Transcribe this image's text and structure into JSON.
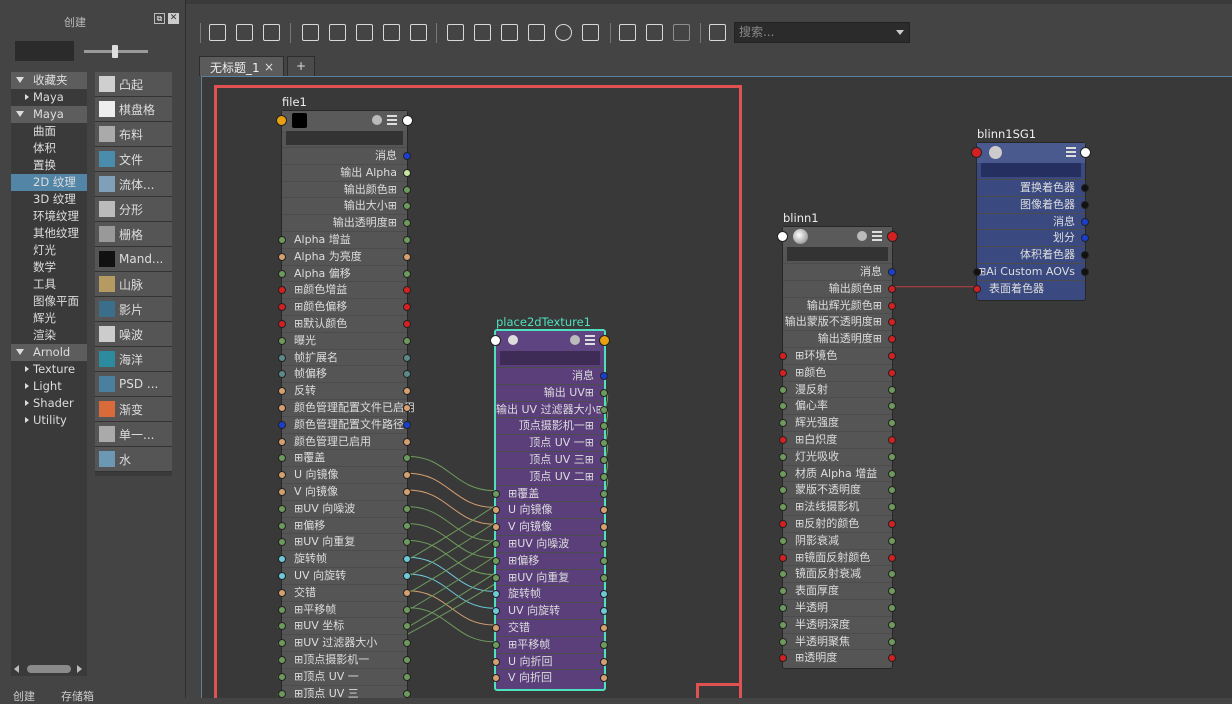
{
  "left_panel": {
    "title": "创建",
    "float_icon": "float-panel-icon",
    "close_icon": "close-icon",
    "categories": [
      {
        "label": "收藏夹",
        "kind": "group"
      },
      {
        "label": "Maya",
        "kind": "sub"
      },
      {
        "label": "Maya",
        "kind": "group"
      },
      {
        "label": "曲面",
        "kind": "item"
      },
      {
        "label": "体积",
        "kind": "item"
      },
      {
        "label": "置换",
        "kind": "item"
      },
      {
        "label": "2D 纹理",
        "kind": "item",
        "selected": true
      },
      {
        "label": "3D 纹理",
        "kind": "item"
      },
      {
        "label": "环境纹理",
        "kind": "item"
      },
      {
        "label": "其他纹理",
        "kind": "item"
      },
      {
        "label": "灯光",
        "kind": "item"
      },
      {
        "label": "数学",
        "kind": "item"
      },
      {
        "label": "工具",
        "kind": "item"
      },
      {
        "label": "图像平面",
        "kind": "item"
      },
      {
        "label": "辉光",
        "kind": "item"
      },
      {
        "label": "渲染",
        "kind": "item"
      },
      {
        "label": "Arnold",
        "kind": "group"
      },
      {
        "label": "Texture",
        "kind": "sub"
      },
      {
        "label": "Light",
        "kind": "sub"
      },
      {
        "label": "Shader",
        "kind": "sub"
      },
      {
        "label": "Utility",
        "kind": "sub"
      }
    ],
    "node_items": [
      {
        "label": "凸起",
        "icon": "bump-grid-icon",
        "color": "#cfcfcf"
      },
      {
        "label": "棋盘格",
        "icon": "checker-icon",
        "color": "#eeeeee"
      },
      {
        "label": "布料",
        "icon": "cloth-icon",
        "color": "#aaaaaa"
      },
      {
        "label": "文件",
        "icon": "file-image-icon",
        "color": "#4a8cab"
      },
      {
        "label": "流体...",
        "icon": "fluid-icon",
        "color": "#7fa0b8"
      },
      {
        "label": "分形",
        "icon": "fractal-icon",
        "color": "#bbbbbb"
      },
      {
        "label": "栅格",
        "icon": "grid-icon",
        "color": "#999999"
      },
      {
        "label": "Mand...",
        "icon": "mandelbrot-icon",
        "color": "#111111"
      },
      {
        "label": "山脉",
        "icon": "mountain-icon",
        "color": "#b59a62"
      },
      {
        "label": "影片",
        "icon": "movie-icon",
        "color": "#3a6e8a"
      },
      {
        "label": "噪波",
        "icon": "noise-icon",
        "color": "#cccccc"
      },
      {
        "label": "海洋",
        "icon": "ocean-icon",
        "color": "#2c8b9e"
      },
      {
        "label": "PSD ...",
        "icon": "psd-icon",
        "color": "#4a7fa0"
      },
      {
        "label": "渐变",
        "icon": "ramp-icon",
        "color": "#d96a3a"
      },
      {
        "label": "单一...",
        "icon": "single-shading-icon",
        "color": "#aaaaaa"
      },
      {
        "label": "水",
        "icon": "water-icon",
        "color": "#6b98b5"
      }
    ],
    "bottom_tabs": [
      "创建",
      "存储箱"
    ]
  },
  "toolbar": {
    "search_placeholder": "搜索..."
  },
  "tabs": {
    "active": "无标题_1",
    "close": "×",
    "add": "+"
  },
  "colors": {
    "selection": "#e05252",
    "place2d_border": "#4fe0c0",
    "place2d_body": "#5a3f7a",
    "sg_body": "#3a4a80",
    "wire": "#c04040"
  },
  "nodes": {
    "file1": {
      "title": "file1",
      "rows": [
        {
          "label": "消息",
          "side": "out",
          "port": "#1a3fd0"
        },
        {
          "label": "输出 Alpha",
          "side": "out",
          "port": "#c8e6a0"
        },
        {
          "label": "输出颜色⊞",
          "side": "out",
          "port": "#6d9a5c"
        },
        {
          "label": "输出大小⊞",
          "side": "out",
          "port": "#6d9a5c"
        },
        {
          "label": "输出透明度⊞",
          "side": "out",
          "port": "#6d9a5c"
        },
        {
          "label": "Alpha 增益",
          "side": "in",
          "port": "#6d9a5c"
        },
        {
          "label": "Alpha 为亮度",
          "side": "in",
          "port": "#d4a070"
        },
        {
          "label": "Alpha 偏移",
          "side": "in",
          "port": "#6d9a5c"
        },
        {
          "label": "⊞颜色增益",
          "side": "in",
          "port": "#d42020"
        },
        {
          "label": "⊞颜色偏移",
          "side": "in",
          "port": "#d42020"
        },
        {
          "label": "⊞默认颜色",
          "side": "in",
          "port": "#d42020"
        },
        {
          "label": "曝光",
          "side": "in",
          "port": "#6d9a5c"
        },
        {
          "label": "帧扩展名",
          "side": "in",
          "port": "#5c8a8a"
        },
        {
          "label": "帧偏移",
          "side": "in",
          "port": "#5c8a8a"
        },
        {
          "label": "反转",
          "side": "in",
          "port": "#d4a070"
        },
        {
          "label": "颜色管理配置文件已启用",
          "side": "in",
          "port": "#d4a070"
        },
        {
          "label": "颜色管理配置文件路径",
          "side": "in",
          "port": "#1a3fd0"
        },
        {
          "label": "颜色管理已启用",
          "side": "in",
          "port": "#d4a070"
        },
        {
          "label": "⊞覆盖",
          "side": "in",
          "port": "#6d9a5c"
        },
        {
          "label": "U 向镜像",
          "side": "in",
          "port": "#d4a070"
        },
        {
          "label": "V 向镜像",
          "side": "in",
          "port": "#d4a070"
        },
        {
          "label": "⊞UV 向噪波",
          "side": "in",
          "port": "#6d9a5c"
        },
        {
          "label": "⊞偏移",
          "side": "in",
          "port": "#6d9a5c"
        },
        {
          "label": "⊞UV 向重复",
          "side": "in",
          "port": "#6d9a5c"
        },
        {
          "label": "旋转帧",
          "side": "in",
          "port": "#6dc8d8"
        },
        {
          "label": "UV 向旋转",
          "side": "in",
          "port": "#6dc8d8"
        },
        {
          "label": "交错",
          "side": "in",
          "port": "#d4a070"
        },
        {
          "label": "⊞平移帧",
          "side": "in",
          "port": "#6d9a5c"
        },
        {
          "label": "⊞UV 坐标",
          "side": "in",
          "port": "#6d9a5c"
        },
        {
          "label": "⊞UV 过滤器大小",
          "side": "in",
          "port": "#6d9a5c"
        },
        {
          "label": "⊞顶点摄影机一",
          "side": "in",
          "port": "#6d9a5c"
        },
        {
          "label": "⊞顶点 UV 一",
          "side": "in",
          "port": "#6d9a5c"
        },
        {
          "label": "⊞顶点 UV 三",
          "side": "in",
          "port": "#6d9a5c"
        }
      ]
    },
    "place2d": {
      "title": "place2dTexture1",
      "rows": [
        {
          "label": "消息",
          "side": "out",
          "port": "#1a3fd0"
        },
        {
          "label": "输出 UV⊞",
          "side": "out",
          "port": "#6d9a5c"
        },
        {
          "label": "输出 UV 过滤器大小⊞",
          "side": "out",
          "port": "#6d9a5c"
        },
        {
          "label": "顶点摄影机一⊞",
          "side": "out",
          "port": "#6d9a5c"
        },
        {
          "label": "顶点 UV 一⊞",
          "side": "out",
          "port": "#6d9a5c"
        },
        {
          "label": "顶点 UV 三⊞",
          "side": "out",
          "port": "#6d9a5c"
        },
        {
          "label": "顶点 UV 二⊞",
          "side": "out",
          "port": "#6d9a5c"
        },
        {
          "label": "⊞覆盖",
          "side": "in",
          "port": "#6d9a5c"
        },
        {
          "label": "U 向镜像",
          "side": "in",
          "port": "#d4a070"
        },
        {
          "label": "V 向镜像",
          "side": "in",
          "port": "#d4a070"
        },
        {
          "label": "⊞UV 向噪波",
          "side": "in",
          "port": "#6d9a5c"
        },
        {
          "label": "⊞偏移",
          "side": "in",
          "port": "#6d9a5c"
        },
        {
          "label": "⊞UV 向重复",
          "side": "in",
          "port": "#6d9a5c"
        },
        {
          "label": "旋转帧",
          "side": "in",
          "port": "#6dc8d8"
        },
        {
          "label": "UV 向旋转",
          "side": "in",
          "port": "#6dc8d8"
        },
        {
          "label": "交错",
          "side": "in",
          "port": "#d4a070"
        },
        {
          "label": "⊞平移帧",
          "side": "in",
          "port": "#6d9a5c"
        },
        {
          "label": "U 向折回",
          "side": "in",
          "port": "#d4a070"
        },
        {
          "label": "V 向折回",
          "side": "in",
          "port": "#d4a070"
        }
      ]
    },
    "blinn1": {
      "title": "blinn1",
      "rows": [
        {
          "label": "消息",
          "side": "out",
          "port": "#1a3fd0"
        },
        {
          "label": "输出颜色⊞",
          "side": "out",
          "port": "#d42020"
        },
        {
          "label": "输出辉光颜色⊞",
          "side": "out",
          "port": "#d42020"
        },
        {
          "label": "输出蒙版不透明度⊞",
          "side": "out",
          "port": "#d42020"
        },
        {
          "label": "输出透明度⊞",
          "side": "out",
          "port": "#d42020"
        },
        {
          "label": "⊞环境色",
          "side": "in",
          "port": "#d42020"
        },
        {
          "label": "⊞颜色",
          "side": "in",
          "port": "#d42020"
        },
        {
          "label": "漫反射",
          "side": "in",
          "port": "#6d9a5c"
        },
        {
          "label": "偏心率",
          "side": "in",
          "port": "#6d9a5c"
        },
        {
          "label": "辉光强度",
          "side": "in",
          "port": "#6d9a5c"
        },
        {
          "label": "⊞白炽度",
          "side": "in",
          "port": "#d42020"
        },
        {
          "label": "灯光吸收",
          "side": "in",
          "port": "#6d9a5c"
        },
        {
          "label": "材质 Alpha 增益",
          "side": "in",
          "port": "#6d9a5c"
        },
        {
          "label": "蒙版不透明度",
          "side": "in",
          "port": "#6d9a5c"
        },
        {
          "label": "⊞法线摄影机",
          "side": "in",
          "port": "#6d9a5c"
        },
        {
          "label": "⊞反射的颜色",
          "side": "in",
          "port": "#d42020"
        },
        {
          "label": "阴影衰减",
          "side": "in",
          "port": "#6d9a5c"
        },
        {
          "label": "⊞镜面反射颜色",
          "side": "in",
          "port": "#d42020"
        },
        {
          "label": "镜面反射衰减",
          "side": "in",
          "port": "#6d9a5c"
        },
        {
          "label": "表面厚度",
          "side": "in",
          "port": "#6d9a5c"
        },
        {
          "label": "半透明",
          "side": "in",
          "port": "#6d9a5c"
        },
        {
          "label": "半透明深度",
          "side": "in",
          "port": "#6d9a5c"
        },
        {
          "label": "半透明聚焦",
          "side": "in",
          "port": "#6d9a5c"
        },
        {
          "label": "⊞透明度",
          "side": "in",
          "port": "#d42020"
        }
      ]
    },
    "blinn1SG": {
      "title": "blinn1SG1",
      "rows": [
        {
          "label": "置换着色器",
          "side": "out",
          "port": "#111111"
        },
        {
          "label": "图像着色器",
          "side": "out",
          "port": "#111111"
        },
        {
          "label": "消息",
          "side": "out",
          "port": "#1a3fd0"
        },
        {
          "label": "划分",
          "side": "out",
          "port": "#1a3fd0"
        },
        {
          "label": "体积着色器",
          "side": "out",
          "port": "#111111"
        },
        {
          "label": "⊞Ai Custom AOVs",
          "side": "both",
          "port": "#111111"
        },
        {
          "label": "表面着色器",
          "side": "in",
          "port": "#d42020"
        }
      ]
    }
  }
}
